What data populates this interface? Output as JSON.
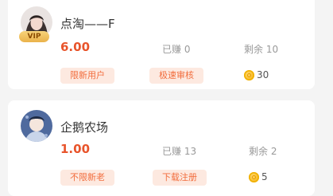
{
  "tasks": [
    {
      "title": "点淘——F",
      "vip_label": "VIP",
      "price": "6.00",
      "earned": "已赚 0",
      "remaining": "剩余 10",
      "tags": [
        "限新用户",
        "极速审核"
      ],
      "coins": "30"
    },
    {
      "title": "企鹅农场",
      "price": "1.00",
      "earned": "已赚 13",
      "remaining": "剩余 2",
      "tags": [
        "不限新老",
        "下载注册"
      ],
      "coins": "5"
    }
  ],
  "colors": {
    "price": "#e8542b",
    "tag_bg": "#fde9e0",
    "tag_text": "#f26d3d",
    "vip_gold": "#eab24a"
  }
}
